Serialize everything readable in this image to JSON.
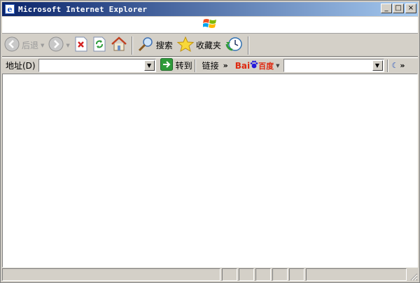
{
  "window": {
    "title": "Microsoft Internet Explorer"
  },
  "title_buttons": {
    "minimize": "_",
    "maximize": "□",
    "close": "×"
  },
  "toolbar": {
    "back_label": "后退",
    "search_label": "搜索",
    "favorites_label": "收藏夹"
  },
  "address_bar": {
    "label": "地址(D)",
    "value": "",
    "go_label": "转到",
    "links_label": "链接"
  },
  "baidu": {
    "logo_text_1": "Bai",
    "logo_text_2": "du",
    "logo_text_3": "百度",
    "value": ""
  },
  "icons": [
    "windows-flag-icon",
    "ie-icon",
    "back-icon",
    "forward-icon",
    "stop-icon",
    "refresh-icon",
    "home-icon",
    "search-icon",
    "favorites-star-icon",
    "history-icon",
    "go-arrow-icon",
    "chevron-icon",
    "resize-grip-icon"
  ],
  "colors": {
    "titlebar_start": "#0a246a",
    "titlebar_end": "#a6caf0",
    "chrome": "#d4d0c8",
    "go_green": "#2e9b3a",
    "baidu_red": "#de2910",
    "baidu_blue": "#2319dc"
  }
}
